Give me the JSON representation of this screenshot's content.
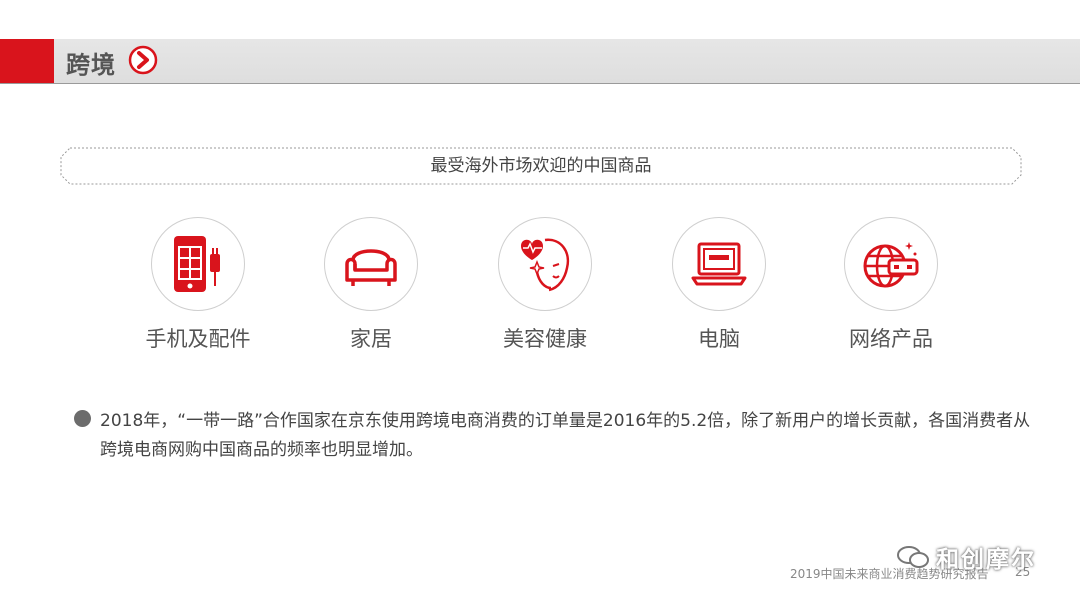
{
  "header": {
    "title": "跨境"
  },
  "banner": {
    "text": "最受海外市场欢迎的中国商品"
  },
  "categories": [
    {
      "label": "手机及配件",
      "icon": "phone-accessories-icon"
    },
    {
      "label": "家居",
      "icon": "sofa-icon"
    },
    {
      "label": "美容健康",
      "icon": "beauty-health-icon"
    },
    {
      "label": "电脑",
      "icon": "laptop-icon"
    },
    {
      "label": "网络产品",
      "icon": "network-globe-icon"
    }
  ],
  "paragraph": "2018年，“一带一路”合作国家在京东使用跨境电商消费的订单量是2016年的5.2倍，除了新用户的增长贡献，各国消费者从跨境电商网购中国商品的频率也明显增加。",
  "footer": {
    "note": "2019中国未来商业消费趋势研究报告",
    "page": "25"
  },
  "watermark": {
    "text": "和创摩尔"
  },
  "colors": {
    "accent": "#d9141c",
    "header_bg": "#e2e2e2"
  }
}
